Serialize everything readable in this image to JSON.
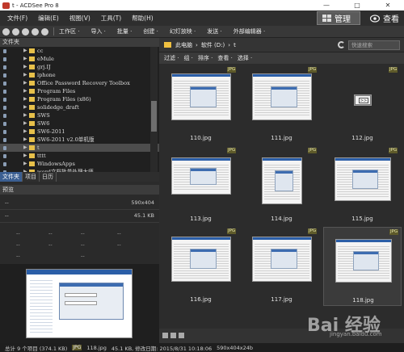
{
  "window": {
    "title": "t - ACDSee Pro 8",
    "minimize": "—",
    "maximize": "□",
    "close": "✕"
  },
  "menu": [
    "文件(F)",
    "编辑(E)",
    "视图(V)",
    "工具(T)",
    "帮助(H)"
  ],
  "modes": {
    "manage": "管理",
    "view": "查看"
  },
  "toolbar": [
    "工作区 ·",
    "导入 ·",
    "批量 ·",
    "创建 ·",
    "幻灯放映 ·",
    "发送 ·",
    "外部编辑器 ·"
  ],
  "folders": {
    "header": "文件夹",
    "items": [
      "cc",
      "eMule",
      "grj.IJ",
      "iphone",
      "Office Password Recovery Toolbox",
      "Program Files",
      "Program Files (x86)",
      "solidedge_draft",
      "SWS",
      "SW6",
      "SW6-2011",
      "SW6-2011 v2.0单机版",
      "t",
      "tttt",
      "WindowsApps",
      "word文档批量处理大师",
      "系统数据备份"
    ],
    "selected": "t"
  },
  "left_tabs": [
    "文件夹",
    "日历",
    "日历"
  ],
  "left_tabs_labels": [
    "文件夹",
    "项目",
    "日历"
  ],
  "preview": {
    "header": "预览",
    "rows": [
      {
        "left": "--",
        "right": "590x404"
      },
      {
        "left": "--",
        "right": "45.1 KB"
      }
    ],
    "grid_placeholders": [
      "--",
      "--",
      "--",
      "--",
      "--",
      "--",
      "--",
      "--",
      "--",
      "--"
    ]
  },
  "path": {
    "crumbs": [
      "此电脑",
      "软件 (D:)",
      "t"
    ],
    "search_placeholder": "快速搜索"
  },
  "filters": [
    "过滤 ·",
    "组 ·",
    "排序 ·",
    "查看 ·",
    "选择 ·"
  ],
  "files": [
    {
      "name": "110.jpg",
      "badge": "JPG"
    },
    {
      "name": "111.jpg",
      "badge": "JPG"
    },
    {
      "name": "112.jpg",
      "badge": "JPG"
    },
    {
      "name": "113.jpg",
      "badge": "JPG"
    },
    {
      "name": "114.jpg",
      "badge": "JPG"
    },
    {
      "name": "115.jpg",
      "badge": "JPG"
    },
    {
      "name": "116.jpg",
      "badge": "JPG"
    },
    {
      "name": "117.jpg",
      "badge": "JPG"
    },
    {
      "name": "118.jpg",
      "badge": "JPG"
    }
  ],
  "status": {
    "total": "总计 9 个项目 (374.1 KB)",
    "type": "JPG",
    "file": "118.jpg",
    "info": "45.1 KB, 修改日期: 2015/8/31 10:18:06",
    "dims": "590x404x24b"
  },
  "watermark": {
    "logo": "Bai 经验",
    "url": "jingyan.baidu.com"
  }
}
